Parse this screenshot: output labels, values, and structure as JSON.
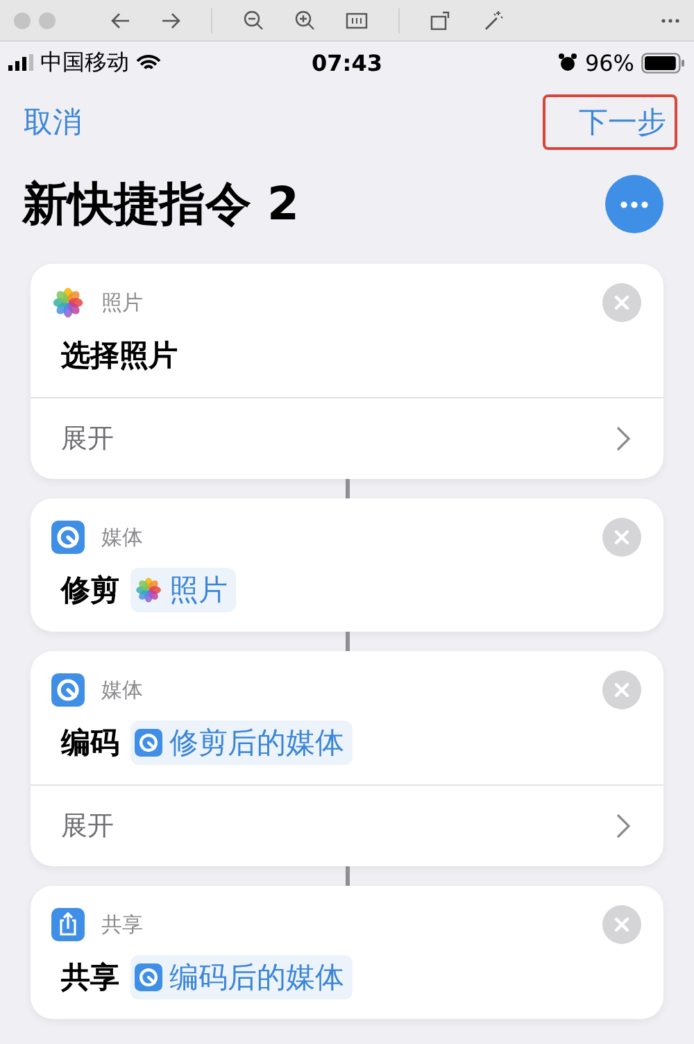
{
  "status_bar": {
    "carrier": "中国移动",
    "time": "07:43",
    "battery": "96%"
  },
  "nav": {
    "cancel": "取消",
    "next": "下一步",
    "next_highlighted": true
  },
  "title": "新快捷指令 2",
  "actions": [
    {
      "kind": "photos",
      "app": "照片",
      "verb": "选择照片",
      "expand": "展开"
    },
    {
      "kind": "media",
      "app": "媒体",
      "verb": "修剪",
      "token": {
        "kind": "photos",
        "label": "照片"
      }
    },
    {
      "kind": "media",
      "app": "媒体",
      "verb": "编码",
      "token": {
        "kind": "media",
        "label": "修剪后的媒体"
      },
      "expand": "展开"
    },
    {
      "kind": "share",
      "app": "共享",
      "verb": "共享",
      "token": {
        "kind": "media",
        "label": "编码后的媒体"
      }
    }
  ]
}
